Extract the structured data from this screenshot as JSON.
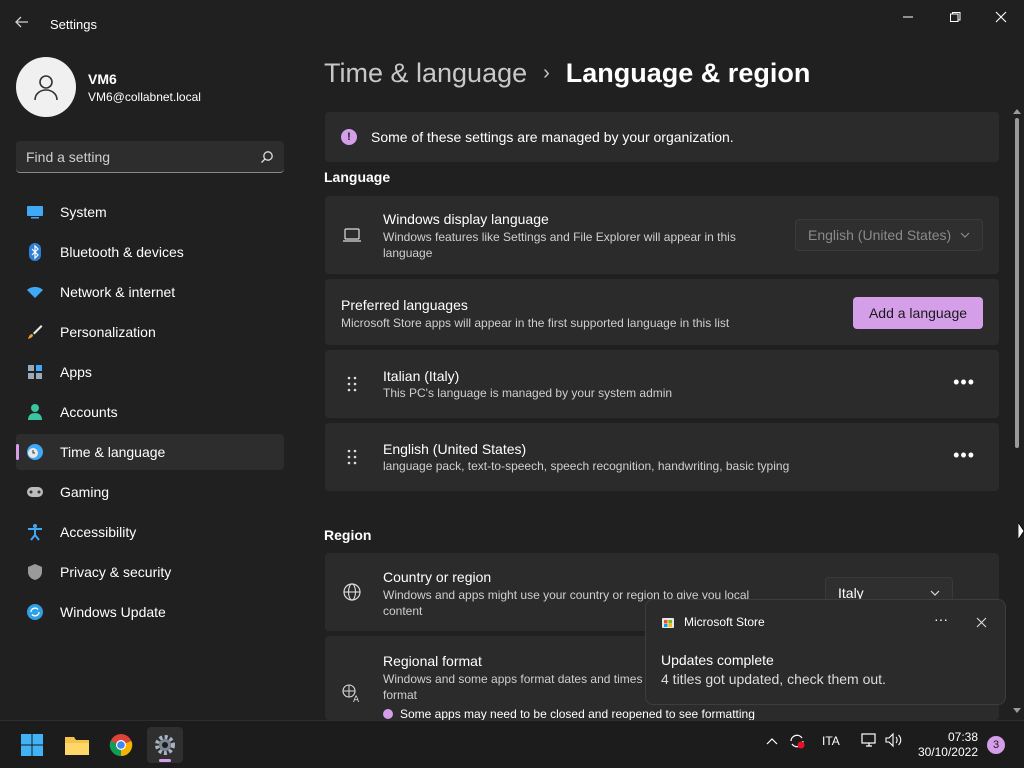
{
  "window": {
    "title": "Settings",
    "back_icon": "back-arrow-icon",
    "controls": [
      "minimize-icon",
      "maximize-icon",
      "close-icon"
    ]
  },
  "profile": {
    "name": "VM6",
    "email": "VM6@collabnet.local",
    "avatar_icon": "user-icon"
  },
  "search": {
    "placeholder": "Find a setting",
    "icon": "search-icon"
  },
  "nav": {
    "items": [
      {
        "label": "System",
        "icon": "monitor-icon"
      },
      {
        "label": "Bluetooth & devices",
        "icon": "bluetooth-icon"
      },
      {
        "label": "Network & internet",
        "icon": "wifi-icon"
      },
      {
        "label": "Personalization",
        "icon": "brush-icon"
      },
      {
        "label": "Apps",
        "icon": "apps-icon"
      },
      {
        "label": "Accounts",
        "icon": "accounts-icon"
      },
      {
        "label": "Time & language",
        "icon": "clock-globe-icon",
        "active": true
      },
      {
        "label": "Gaming",
        "icon": "gamepad-icon"
      },
      {
        "label": "Accessibility",
        "icon": "accessibility-icon"
      },
      {
        "label": "Privacy & security",
        "icon": "shield-icon"
      },
      {
        "label": "Windows Update",
        "icon": "update-icon"
      }
    ]
  },
  "breadcrumb": {
    "parent": "Time & language",
    "separator": "›",
    "current": "Language & region"
  },
  "banner": {
    "text": "Some of these settings are managed by your organization."
  },
  "language": {
    "section_title": "Language",
    "display_language": {
      "title": "Windows display language",
      "subtitle": "Windows features like Settings and File Explorer will appear in this language",
      "value": "English (United States)"
    },
    "preferred": {
      "title": "Preferred languages",
      "subtitle": "Microsoft Store apps will appear in the first supported language in this list",
      "button": "Add a language"
    },
    "languages": [
      {
        "name": "Italian (Italy)",
        "detail": "This PC's language is managed by your system admin"
      },
      {
        "name": "English (United States)",
        "detail": "language pack, text-to-speech, speech recognition, handwriting, basic typing"
      }
    ],
    "more_label": "•••"
  },
  "region": {
    "section_title": "Region",
    "country": {
      "title": "Country or region",
      "subtitle": "Windows and apps might use your country or region to give you local content",
      "value": "Italy"
    },
    "format": {
      "title": "Regional format",
      "subtitle": "Windows and some apps format dates and times",
      "subtitle_cont": "format",
      "note": "Some apps may need to be closed and reopened to see formatting"
    }
  },
  "toast": {
    "app": "Microsoft Store",
    "title": "Updates complete",
    "body": "4 titles got updated, check them out.",
    "more_label": "···"
  },
  "taskbar": {
    "apps": [
      "windows-start-icon",
      "file-explorer-icon",
      "chrome-icon",
      "settings-gear-icon"
    ],
    "language": "ITA",
    "time": "07:38",
    "date": "30/10/2022",
    "notifications": "3"
  },
  "colors": {
    "accent": "#d49ee8",
    "background": "#202020",
    "card": "#2b2b2b"
  }
}
